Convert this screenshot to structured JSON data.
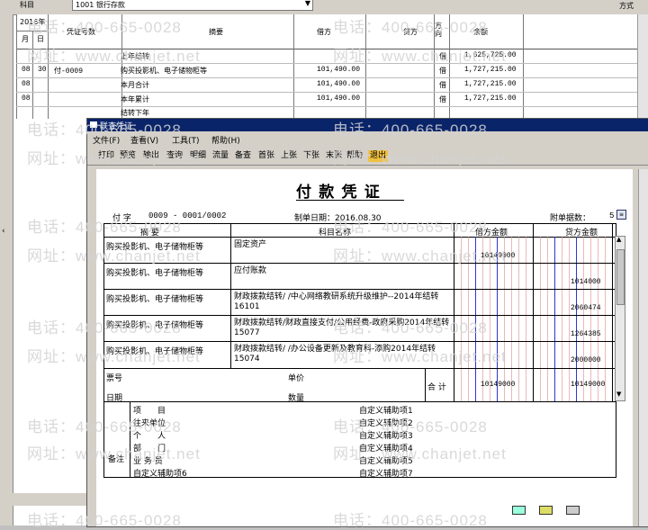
{
  "ledger": {
    "header_combo": "1001 银行存款",
    "right_label": "方式",
    "year": "2016年",
    "month": "月",
    "day": "日",
    "columns": [
      "凭证号数",
      "摘要",
      "借方",
      "贷方",
      "方向",
      "余额"
    ],
    "rows": [
      {
        "m": "",
        "d": "",
        "no": "",
        "summary": "上年结转",
        "debit": "",
        "credit": "",
        "dir": "借",
        "bal": "1,625,725.00"
      },
      {
        "m": "08",
        "d": "30",
        "no": "付-0009",
        "summary": "购买投影机、电子储物柜等",
        "debit": "101,490.00",
        "credit": "",
        "dir": "借",
        "bal": "1,727,215.00"
      },
      {
        "m": "08",
        "d": "",
        "no": "",
        "summary": "本月合计",
        "debit": "101,490.00",
        "credit": "",
        "dir": "借",
        "bal": "1,727,215.00"
      },
      {
        "m": "08",
        "d": "",
        "no": "",
        "summary": "本年累计",
        "debit": "101,490.00",
        "credit": "",
        "dir": "借",
        "bal": "1,727,215.00"
      },
      {
        "m": "",
        "d": "",
        "no": "",
        "summary": "结转下年",
        "debit": "",
        "credit": "",
        "dir": "",
        "bal": ""
      }
    ]
  },
  "dialog": {
    "title": "联查凭证",
    "menu": [
      "文件(F)",
      "查看(V)",
      "工具(T)",
      "帮助(H)"
    ],
    "toolbar": [
      "打印",
      "预览",
      "输出",
      "查询",
      "明细",
      "流量",
      "备查",
      "首张",
      "上张",
      "下张",
      "末张",
      "帮助",
      "退出"
    ],
    "voucher": {
      "title": "付 款 凭 证",
      "type_label": "付 字",
      "voucher_no": "0009 - 0001/0002",
      "date_label": "制单日期：2016.08.30",
      "attach_label": "附单据数：",
      "attach_count": "5",
      "col_summary": "摘 要",
      "col_account": "科目名称",
      "col_debit": "借方金额",
      "col_credit": "贷方金额",
      "entries": [
        {
          "summary": "购买投影机、电子储物柜等",
          "account": "固定资产",
          "debit": "10149000",
          "credit": ""
        },
        {
          "summary": "购买投影机、电子储物柜等",
          "account": "应付账款",
          "debit": "",
          "credit": "1014000"
        },
        {
          "summary": "购买投影机、电子储物柜等",
          "account": "财政拨款结转/    /中心网络教研系统升级维护--2014年结转16101",
          "debit": "",
          "credit": "2060474"
        },
        {
          "summary": "购买投影机、电子储物柜等",
          "account": "财政拨款结转/财政直接支付/公用经费-政府采购2014年结转15077",
          "debit": "",
          "credit": "1264385"
        },
        {
          "summary": "购买投影机、电子储物柜等",
          "account": "财政拨款结转/    /办公设备更新及教育科-添购2014年结转15074",
          "debit": "",
          "credit": "2000000"
        }
      ],
      "bill_no_label": "票号",
      "date2_label": "日期",
      "price_label": "单价",
      "qty_label": "数量",
      "total_label": "合 计",
      "total_debit": "10149000",
      "total_credit": "10149000",
      "remark_label": "备注",
      "aux_left": [
        "项　　目",
        "往来单位",
        "个　　人",
        "部　　门",
        "业 务 员",
        "自定义辅助项6"
      ],
      "aux_right": [
        "自定义辅助项1",
        "自定义辅助项2",
        "自定义辅助项3",
        "自定义辅助项4",
        "自定义辅助项5",
        "自定义辅助项7"
      ]
    }
  },
  "watermark": {
    "phone": "电话：400-665-0028",
    "site": "网址：www.chanjet.net"
  }
}
